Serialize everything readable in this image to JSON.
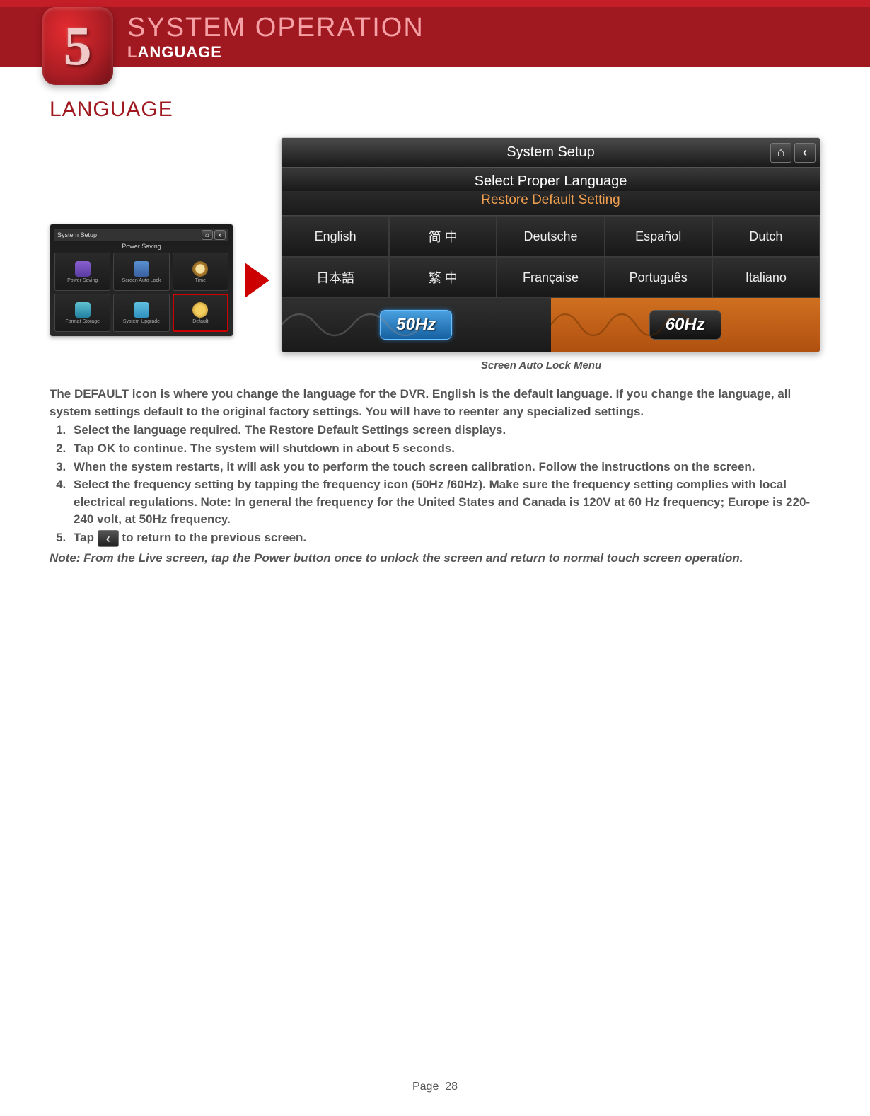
{
  "chapter": {
    "number": "5",
    "title": "SYSTEM OPERATION",
    "subtitle": "LANGUAGE"
  },
  "section_heading": "LANGUAGE",
  "thumbnail": {
    "title": "System Setup",
    "subtitle": "Power Saving",
    "cells": [
      {
        "label": "Power Saving"
      },
      {
        "label": "Screen Auto Lock"
      },
      {
        "label": "Time"
      },
      {
        "label": "Format Storage"
      },
      {
        "label": "System Upgrade"
      },
      {
        "label": "Default"
      }
    ]
  },
  "mainscreen": {
    "title": "System Setup",
    "sub1": "Select Proper Language",
    "sub2": "Restore Default Setting",
    "icons": {
      "home": "⌂",
      "back": "‹"
    },
    "languages": [
      "English",
      "简 中",
      "Deutsche",
      "Español",
      "Dutch",
      "日本語",
      "繁 中",
      "Française",
      "Português",
      "Italiano"
    ],
    "freq": {
      "left": "50Hz",
      "right": "60Hz"
    }
  },
  "caption": "Screen Auto Lock Menu",
  "intro": "The DEFAULT icon is where you change the language for the DVR. English is the default language. If you change the language, all system settings default to the original factory settings. You will have to reenter any specialized settings.",
  "steps": [
    "Select the language required. The Restore Default Settings screen displays.",
    "Tap OK to continue. The system will shutdown in about 5 seconds.",
    "When the system restarts, it will ask you to perform the touch screen calibration. Follow the instructions on the screen.",
    "Select the frequency setting by tapping the frequency icon (50Hz /60Hz). Make sure the frequency setting complies with local electrical regulations. Note: In general the frequency for the United States and Canada is 120V at 60 Hz frequency; Europe is 220-240 volt, at 50Hz frequency."
  ],
  "step5_prefix": "Tap ",
  "step5_icon_name": "back-icon",
  "step5_suffix": " to return to the previous screen.",
  "note": "Note: From the Live screen, tap the Power button once to unlock the screen and return to normal touch screen operation.",
  "footer": {
    "label": "Page",
    "number": "28"
  }
}
